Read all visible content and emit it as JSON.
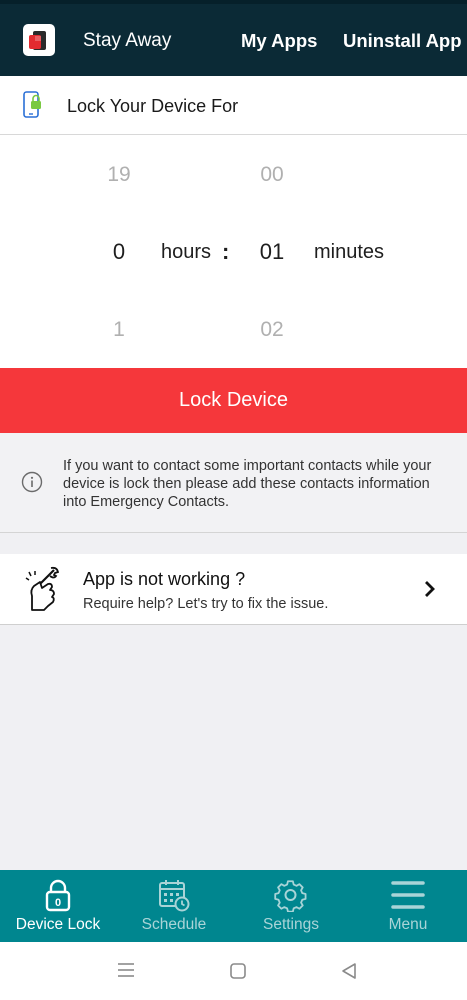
{
  "header": {
    "app_title": "Stay Away",
    "nav_my_apps": "My Apps",
    "nav_uninstall": "Uninstall App"
  },
  "lock_section": {
    "title": "Lock Your Device For"
  },
  "picker": {
    "hours": {
      "prev": "19",
      "selected": "0",
      "next": "1",
      "unit_label": "hours"
    },
    "separator": ":",
    "minutes": {
      "prev": "00",
      "selected": "01",
      "next": "02",
      "unit_label": "minutes"
    }
  },
  "lock_button": {
    "label": "Lock Device"
  },
  "info": {
    "message": "If you want to contact some important contacts while your device is lock then please add these contacts information into Emergency Contacts."
  },
  "help": {
    "title": "App is not working ?",
    "subtitle": "Require help? Let's try to fix the issue."
  },
  "bottom_nav": {
    "tabs": [
      {
        "label": "Device Lock",
        "icon": "lock-icon",
        "active": true
      },
      {
        "label": "Schedule",
        "icon": "calendar-icon",
        "active": false
      },
      {
        "label": "Settings",
        "icon": "gear-icon",
        "active": false
      },
      {
        "label": "Menu",
        "icon": "hamburger-menu-icon",
        "active": false
      }
    ],
    "lock_badge": "0"
  },
  "system_nav": {
    "buttons": [
      "recent-apps-icon",
      "home-icon",
      "back-icon"
    ]
  },
  "colors": {
    "top_bar": "#0b2a36",
    "accent_red": "#f5373b",
    "bottom_nav": "#00868f",
    "inactive_tab": "#a9d4d7"
  }
}
